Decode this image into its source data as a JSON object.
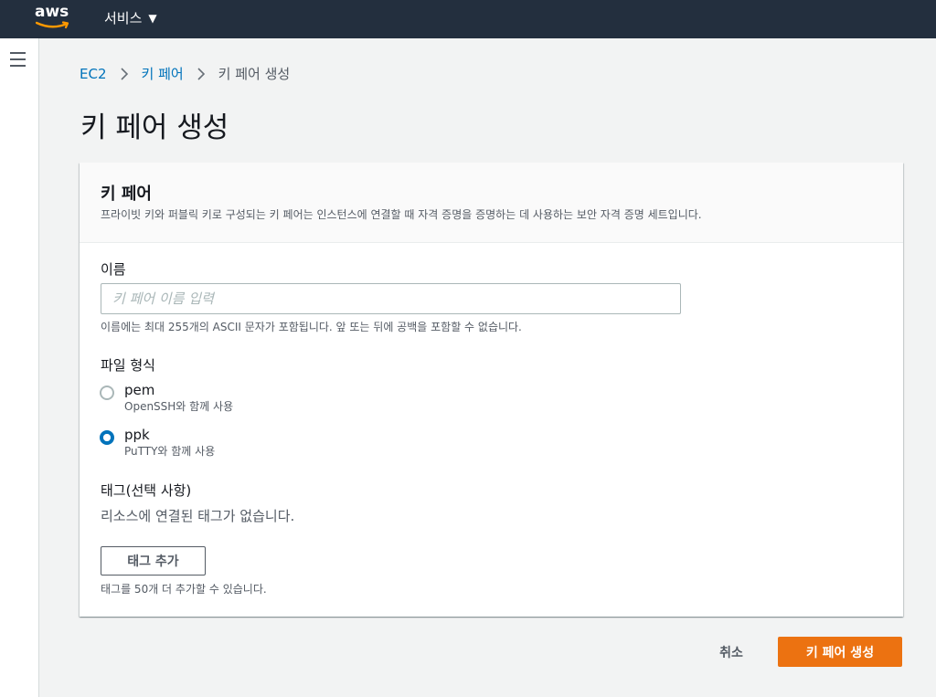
{
  "topbar": {
    "logo_text": "aws",
    "services_label": "서비스",
    "services_caret": "▼"
  },
  "breadcrumb": {
    "items": [
      "EC2",
      "키 페어"
    ],
    "current": "키 페어 생성"
  },
  "page": {
    "title": "키 페어 생성"
  },
  "panel": {
    "title": "키 페어",
    "description": "프라이빗 키와 퍼블릭 키로 구성되는 키 페어는 인스턴스에 연결할 때 자격 증명을 증명하는 데 사용하는 보안 자격 증명 세트입니다."
  },
  "name_field": {
    "label": "이름",
    "value": "",
    "placeholder": "키 페어 이름 입력",
    "hint": "이름에는 최대 255개의 ASCII 문자가 포함됩니다. 앞 또는 뒤에 공백을 포함할 수 없습니다."
  },
  "file_format": {
    "label": "파일 형식",
    "options": [
      {
        "title": "pem",
        "description": "OpenSSH와 함께 사용",
        "checked": false
      },
      {
        "title": "ppk",
        "description": "PuTTY와 함께 사용",
        "checked": true
      }
    ]
  },
  "tags": {
    "label": "태그(선택 사항)",
    "empty_text": "리소스에 연결된 태그가 없습니다.",
    "add_button": "태그 추가",
    "hint": "태그를 50개 더 추가할 수 있습니다."
  },
  "actions": {
    "cancel": "취소",
    "create": "키 페어 생성"
  },
  "colors": {
    "topbar": "#232f3e",
    "link": "#0073bb",
    "primary": "#ec7211",
    "logo_smile": "#ff9900"
  }
}
